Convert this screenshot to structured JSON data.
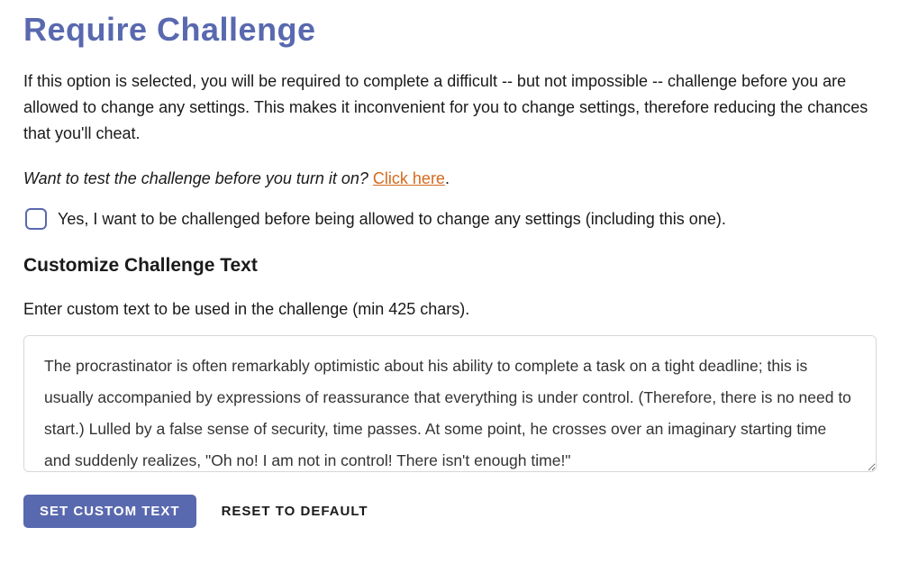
{
  "title": "Require Challenge",
  "description": "If this option is selected, you will be required to complete a difficult -- but not impossible -- challenge before you are allowed to change any settings. This makes it inconvenient for you to change settings, therefore reducing the chances that you'll cheat.",
  "test_prompt": {
    "text": "Want to test the challenge before you turn it on? ",
    "link_text": "Click here",
    "period": "."
  },
  "checkbox": {
    "checked": false,
    "label": "Yes, I want to be challenged before being allowed to change any settings (including this one)."
  },
  "customize": {
    "heading": "Customize Challenge Text",
    "instruction": "Enter custom text to be used in the challenge (min 425 chars).",
    "textarea_value": "The procrastinator is often remarkably optimistic about his ability to complete a task on a tight deadline; this is usually accompanied by expressions of reassurance that everything is under control. (Therefore, there is no need to start.) Lulled by a false sense of security, time passes. At some point, he crosses over an imaginary starting time and suddenly realizes, \"Oh no! I am not in control! There isn't enough time!\""
  },
  "buttons": {
    "set_custom_text": "SET CUSTOM TEXT",
    "reset_default": "RESET TO DEFAULT"
  }
}
